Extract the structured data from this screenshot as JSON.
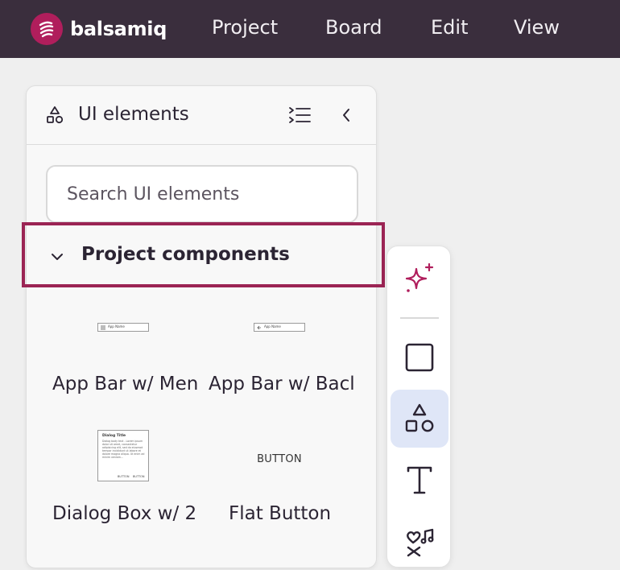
{
  "app": {
    "logo_text": "balsamiq",
    "menu": [
      "Project",
      "Board",
      "Edit",
      "View"
    ]
  },
  "panel": {
    "title": "UI elements",
    "search_placeholder": "Search UI elements",
    "section_title": "Project components",
    "components": [
      {
        "label": "App Bar w/ Men",
        "thumb_text": "App Name",
        "thumb_icon": "menu-icon"
      },
      {
        "label": "App Bar w/ Bacl",
        "thumb_text": "App Name",
        "thumb_icon": "back-arrow-icon"
      },
      {
        "label": "Dialog Box w/ 2",
        "thumb_title": "Dialog Title",
        "thumb_body": "Dialog body text - Lorem ipsum dolor sit amet, consectetur adipisicing elit, sed do eiusmod tempor incididunt ut labore et dolore magna aliqua. Ut enim ad minim veniam...",
        "thumb_buttons": [
          "BUTTON",
          "BUTTON"
        ]
      },
      {
        "label": "Flat Button",
        "thumb_text": "BUTTON"
      }
    ]
  },
  "toolbar": {
    "tools": [
      "ai-sparkle-icon",
      "rectangle-icon",
      "shapes-icon",
      "text-icon",
      "icons-icon"
    ],
    "active_tool": "shapes-icon"
  },
  "colors": {
    "topbar": "#3a2e3d",
    "brand": "#b01e5c",
    "highlight": "#9b2454",
    "active_tool_bg": "#dfe6f7"
  }
}
